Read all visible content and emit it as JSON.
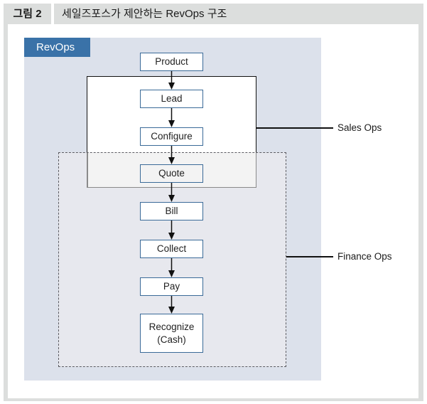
{
  "figure": {
    "number_label": "그림 2",
    "title": "세일즈포스가 제안하는 RevOps 구조"
  },
  "diagram": {
    "container_label": "RevOps",
    "steps": [
      {
        "label": "Product"
      },
      {
        "label": "Lead"
      },
      {
        "label": "Configure"
      },
      {
        "label": "Quote"
      },
      {
        "label": "Bill"
      },
      {
        "label": "Collect"
      },
      {
        "label": "Pay"
      },
      {
        "label": "Recognize\n(Cash)"
      }
    ],
    "groups": [
      {
        "label": "Sales Ops",
        "covers": [
          "Lead",
          "Configure",
          "Quote"
        ],
        "style": "solid"
      },
      {
        "label": "Finance Ops",
        "covers": [
          "Quote",
          "Bill",
          "Collect",
          "Pay",
          "Recognize (Cash)"
        ],
        "style": "dashed"
      }
    ],
    "colors": {
      "frame": "#dcdedd",
      "revops_panel": "#dce1eb",
      "revops_label": "#3a72a8",
      "step_border": "#3a6a98",
      "finance_region": "#e7e8ee",
      "overlap_region": "#f3f3f3"
    }
  }
}
